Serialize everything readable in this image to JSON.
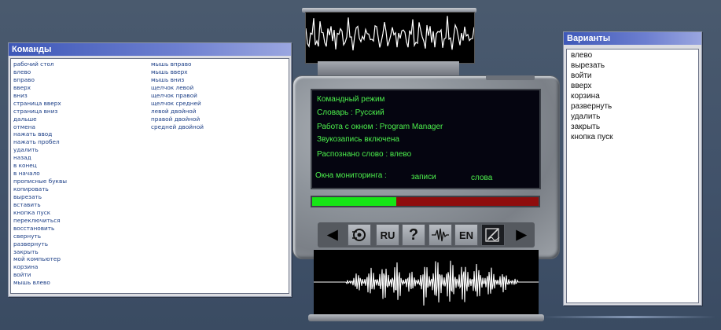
{
  "commands_panel": {
    "title": "Команды",
    "column1": [
      "рабочий стол",
      "влево",
      "вправо",
      "вверх",
      "вниз",
      "страница вверх",
      "страница вниз",
      "дальше",
      "отмена",
      "нажать ввод",
      "нажать пробел",
      "удалить",
      "назад",
      "в конец",
      "в начало",
      "прописные буквы",
      "копировать",
      "вырезать",
      "вставить",
      "кнопка пуск",
      "переключиться",
      "восстановить",
      "свернуть",
      "развернуть",
      "закрыть",
      "мой компьютер",
      "корзина",
      "войти",
      "мышь влево"
    ],
    "column2": [
      "мышь вправо",
      "мышь вверх",
      "мышь вниз",
      "щелчок левой",
      "щелчок правой",
      "щелчок средней",
      "левой двойной",
      "правой двойной",
      "средней двойной"
    ]
  },
  "variants_panel": {
    "title": "Варианты",
    "items": [
      "влево",
      "вырезать",
      "войти",
      "вверх",
      "корзина",
      "развернуть",
      "удалить",
      "закрыть",
      "кнопка пуск"
    ]
  },
  "display": {
    "mode": "Командный режим",
    "dictionary": "Словарь : Русский",
    "window": "Работа с окном : Program Manager",
    "recording": "Звукозапись включена",
    "recognized": "Распознано слово : влево",
    "monitor_label": "Окна мониторинга :",
    "monitor_records": "записи",
    "monitor_words": "слова"
  },
  "level_meter": {
    "fraction": 0.37,
    "green_color": "#16e516",
    "red_color": "#8f0d0d"
  },
  "toolbar": {
    "buttons": [
      {
        "name": "prev-arrow",
        "icon": "triangle-left-icon",
        "label": ""
      },
      {
        "name": "engine",
        "icon": "gear-hand-icon",
        "label": ""
      },
      {
        "name": "lang-ru",
        "icon": "",
        "label": "RU"
      },
      {
        "name": "help",
        "icon": "question-icon",
        "label": "?"
      },
      {
        "name": "waveform",
        "icon": "waveform-icon",
        "label": ""
      },
      {
        "name": "lang-en",
        "icon": "",
        "label": "EN"
      },
      {
        "name": "dictionary-edit",
        "icon": "edit-document-icon",
        "label": ""
      },
      {
        "name": "next-arrow",
        "icon": "triangle-right-icon",
        "label": ""
      }
    ]
  },
  "colors": {
    "display_text": "#4cf04c",
    "title_bar": "#3e58b8",
    "list_text": "#1b3e86"
  }
}
